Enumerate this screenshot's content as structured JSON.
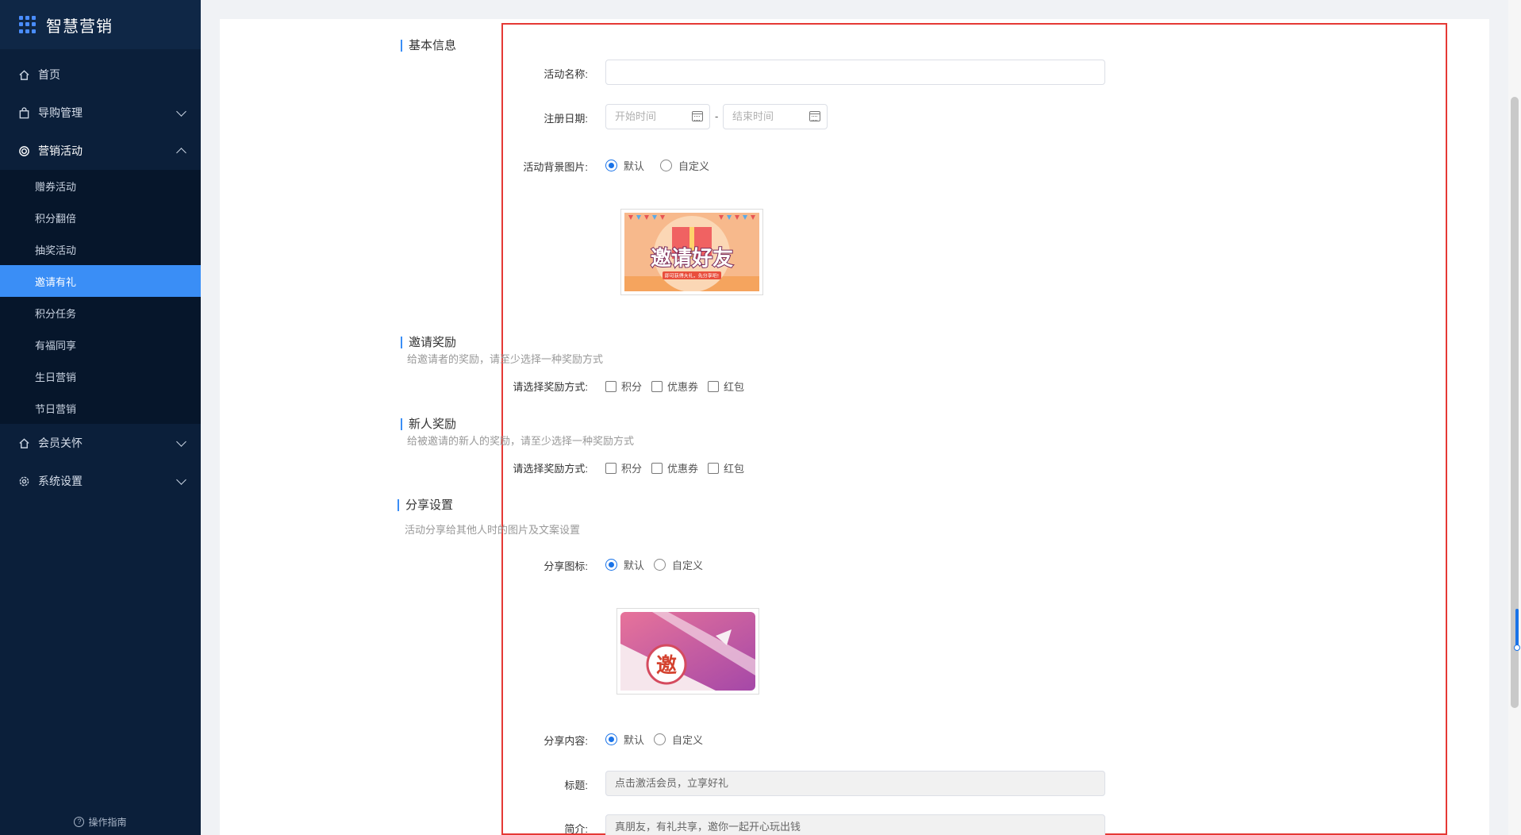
{
  "brand": {
    "title": "智慧营销"
  },
  "sidebar": {
    "items": [
      {
        "label": "首页",
        "icon": "home-icon"
      },
      {
        "label": "导购管理",
        "icon": "bag-icon"
      },
      {
        "label": "营销活动",
        "icon": "target-icon",
        "open": true,
        "children": [
          {
            "label": "赠券活动"
          },
          {
            "label": "积分翻倍"
          },
          {
            "label": "抽奖活动"
          },
          {
            "label": "邀请有礼",
            "active": true
          },
          {
            "label": "积分任务"
          },
          {
            "label": "有福同享"
          },
          {
            "label": "生日营销"
          },
          {
            "label": "节日营销"
          }
        ]
      },
      {
        "label": "会员关怀",
        "icon": "home-icon"
      },
      {
        "label": "系统设置",
        "icon": "gear-icon"
      }
    ],
    "guide": "操作指南"
  },
  "form": {
    "basic": {
      "title": "基本信息",
      "name_label": "活动名称:",
      "name_value": "",
      "date_label": "注册日期:",
      "date_start_placeholder": "开始时间",
      "date_sep": "-",
      "date_end_placeholder": "结束时间",
      "bg_label": "活动背景图片:",
      "bg_options": [
        "默认",
        "自定义"
      ],
      "bg_selected": "默认",
      "banner_text": "邀请好友",
      "banner_sub": "即可获得大礼，先分享吧!"
    },
    "inviter_reward": {
      "title": "邀请奖励",
      "desc": "给邀请者的奖励，请至少选择一种奖励方式",
      "label": "请选择奖励方式:",
      "options": [
        "积分",
        "优惠券",
        "红包"
      ]
    },
    "new_reward": {
      "title": "新人奖励",
      "desc": "给被邀请的新人的奖励，请至少选择一种奖励方式",
      "label": "请选择奖励方式:",
      "options": [
        "积分",
        "优惠券",
        "红包"
      ]
    },
    "share": {
      "title": "分享设置",
      "desc": "活动分享给其他人时的图片及文案设置",
      "icon_label": "分享图标:",
      "icon_options": [
        "默认",
        "自定义"
      ],
      "icon_char": "邀",
      "content_label": "分享内容:",
      "content_options": [
        "默认",
        "自定义"
      ],
      "title_label": "标题:",
      "title_value": "点击激活会员，立享好礼",
      "intro_label": "简介:",
      "intro_value": "真朋友，有礼共享，邀你一起开心玩出钱"
    }
  },
  "colors": {
    "sidebar_bg": "#0b1f3a",
    "accent": "#3a8ef6",
    "highlight_border": "#e53935"
  }
}
